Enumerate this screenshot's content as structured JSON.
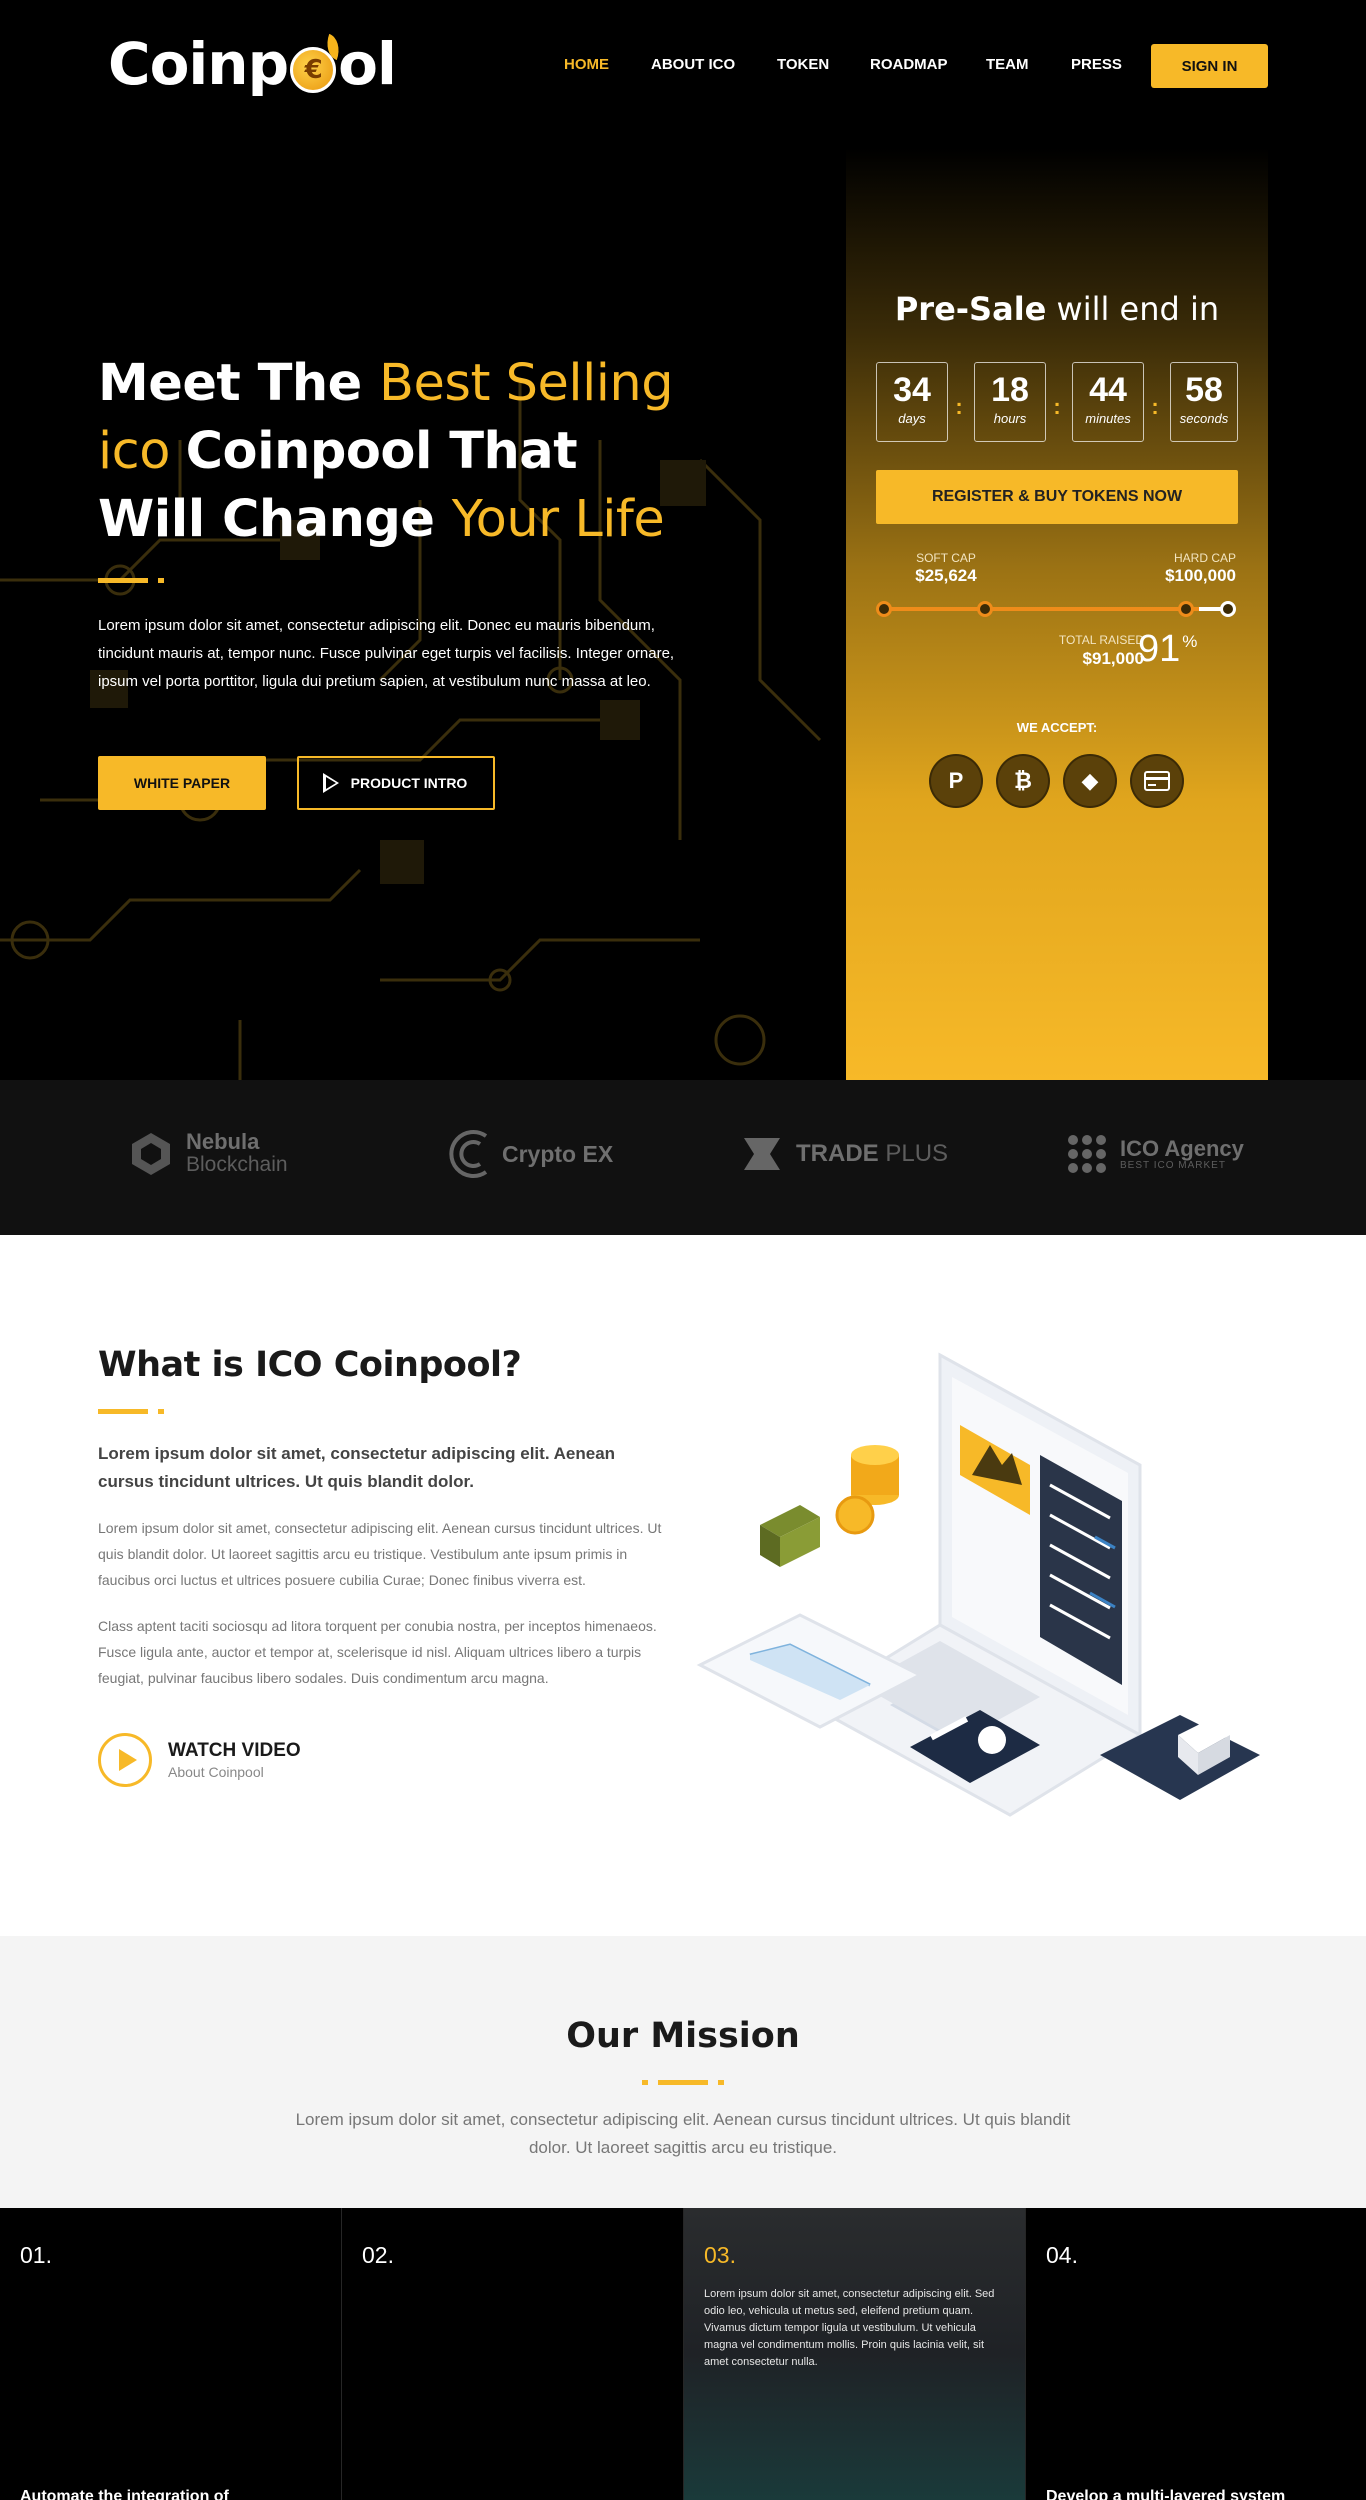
{
  "header": {
    "logo_text_left": "Coinp",
    "logo_coin_glyph": "€",
    "logo_text_right": "ol",
    "nav": [
      "HOME",
      "ABOUT  ICO",
      "TOKEN",
      "ROADMAP",
      "TEAM",
      "PRESS"
    ],
    "active_nav": "HOME",
    "signin_label": "SIGN IN"
  },
  "hero": {
    "title_line1_white": "Meet The ",
    "title_line1_yellow": "Best Selling",
    "title_line2_yellow": "ico ",
    "title_line2_white": "Coinpool That",
    "title_line3_white": "Will Change ",
    "title_line3_yellow": "Your Life",
    "lead": "Lorem ipsum dolor sit amet, consectetur adipiscing elit. Donec eu mauris bibendum, tincidunt mauris at, tempor nunc. Fusce pulvinar eget turpis vel facilisis. Integer ornare, ipsum vel porta porttitor, ligula dui pretium sapien, at vestibulum nunc massa at leo.",
    "white_paper_label": "WHITE PAPER",
    "product_intro_label": "PRODUCT INTRO"
  },
  "presale": {
    "title_bold": "Pre-Sale",
    "title_rest": " will end in",
    "countdown": [
      {
        "value": "34",
        "unit": "days"
      },
      {
        "value": "18",
        "unit": "hours"
      },
      {
        "value": "44",
        "unit": "minutes"
      },
      {
        "value": "58",
        "unit": "seconds"
      }
    ],
    "register_label": "REGISTER & BUY TOKENS NOW",
    "soft_cap_label": "SOFT CAP",
    "soft_cap_value": "$25,624",
    "hard_cap_label": "HARD CAP",
    "hard_cap_value": "$100,000",
    "total_raised_label": "TOTAL RAISED",
    "total_raised_value": "$91,000",
    "percent_value": "91",
    "percent_sign": "%",
    "progress_fraction": 0.91,
    "accept_label": "WE ACCEPT:",
    "payment_icons": [
      "paypal-icon",
      "bitcoin-icon",
      "ethereum-icon",
      "credit-card-icon"
    ]
  },
  "partners": [
    {
      "name": "Nebula",
      "sub": "Blockchain",
      "icon": "nebula-logo-icon"
    },
    {
      "name": "Crypto EX",
      "sub": "",
      "icon": "crypto-ex-logo-icon"
    },
    {
      "name": "TRADE",
      "sub": " PLUS",
      "icon": "trade-plus-logo-icon"
    },
    {
      "name": "ICO Agency",
      "sub": "BEST ICO MARKET",
      "icon": "ico-agency-logo-icon"
    }
  ],
  "about": {
    "title": "What is ICO Coinpool?",
    "strong": "Lorem ipsum dolor sit amet, consectetur adipiscing elit. Aenean cursus tincidunt ultrices. Ut quis blandit dolor.",
    "para1": "Lorem ipsum dolor sit amet, consectetur adipiscing elit. Aenean cursus tincidunt ultrices. Ut quis blandit dolor. Ut laoreet sagittis arcu eu tristique. Vestibulum ante ipsum primis in faucibus orci luctus et ultrices posuere cubilia Curae; Donec finibus viverra est.",
    "para2": "Class aptent taciti sociosqu ad litora torquent per conubia nostra, per inceptos himenaeos. Fusce ligula ante, auctor et tempor at, scelerisque id nisl. Aliquam ultrices libero a turpis feugiat, pulvinar faucibus libero sodales. Duis condimentum arcu magna.",
    "watch_title": "WATCH VIDEO",
    "watch_sub": "About Coinpool"
  },
  "mission": {
    "title": "Our Mission",
    "text": "Lorem ipsum dolor sit amet, consectetur adipiscing elit. Aenean cursus tincidunt ultrices. Ut quis blandit dolor. Ut laoreet sagittis arcu eu tristique."
  },
  "steps": [
    {
      "num": "01.",
      "title": "Automate the integration of",
      "body": ""
    },
    {
      "num": "02.",
      "title": "",
      "body": ""
    },
    {
      "num": "03.",
      "title": "",
      "body": "Lorem ipsum dolor sit amet, consectetur adipiscing elit. Sed odio leo, vehicula ut metus sed, eleifend pretium quam. Vivamus dictum tempor ligula ut vestibulum. Ut vehicula magna vel condimentum mollis. Proin quis lacinia velit, sit amet consectetur nulla."
    },
    {
      "num": "04.",
      "title": "Develop a multi-layered system",
      "body": ""
    }
  ],
  "colors": {
    "accent": "#f7b928",
    "dark": "#000000",
    "panel_dark": "#111111"
  }
}
